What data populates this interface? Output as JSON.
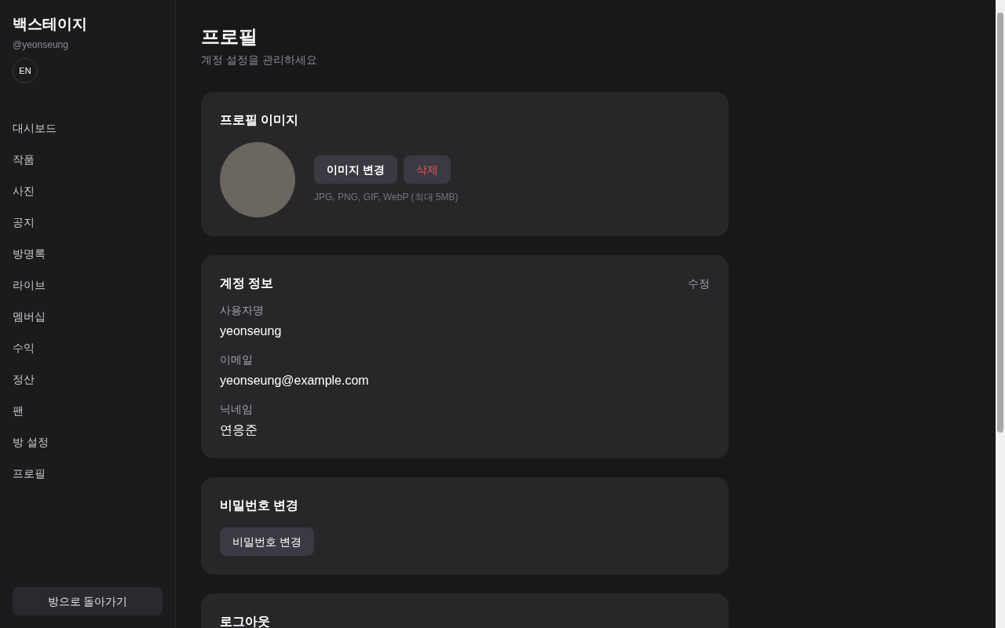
{
  "sidebar": {
    "brand": "백스테이지",
    "handle": "@yeonseung",
    "language_button": "EN",
    "items": [
      {
        "label": "대시보드"
      },
      {
        "label": "작품"
      },
      {
        "label": "사진"
      },
      {
        "label": "공지"
      },
      {
        "label": "방명록"
      },
      {
        "label": "라이브"
      },
      {
        "label": "멤버십"
      },
      {
        "label": "수익"
      },
      {
        "label": "정산"
      },
      {
        "label": "팬"
      },
      {
        "label": "방 설정"
      },
      {
        "label": "프로필"
      }
    ],
    "back_button": "방으로 돌아가기"
  },
  "header": {
    "title": "프로필",
    "subtitle": "계정 설정을 관리하세요"
  },
  "profile_image": {
    "title": "프로필 이미지",
    "change_button": "이미지 변경",
    "delete_button": "삭제",
    "hint": "JPG, PNG, GIF, WebP (최대 5MB)"
  },
  "account": {
    "title": "계정 정보",
    "edit_link": "수정",
    "fields": [
      {
        "label": "사용자명",
        "value": "yeonseung"
      },
      {
        "label": "이메일",
        "value": "yeonseung@example.com"
      },
      {
        "label": "닉네임",
        "value": "연응준"
      }
    ]
  },
  "password": {
    "title": "비밀번호 변경",
    "button": "비밀번호 변경"
  },
  "logout": {
    "title": "로그아웃"
  }
}
